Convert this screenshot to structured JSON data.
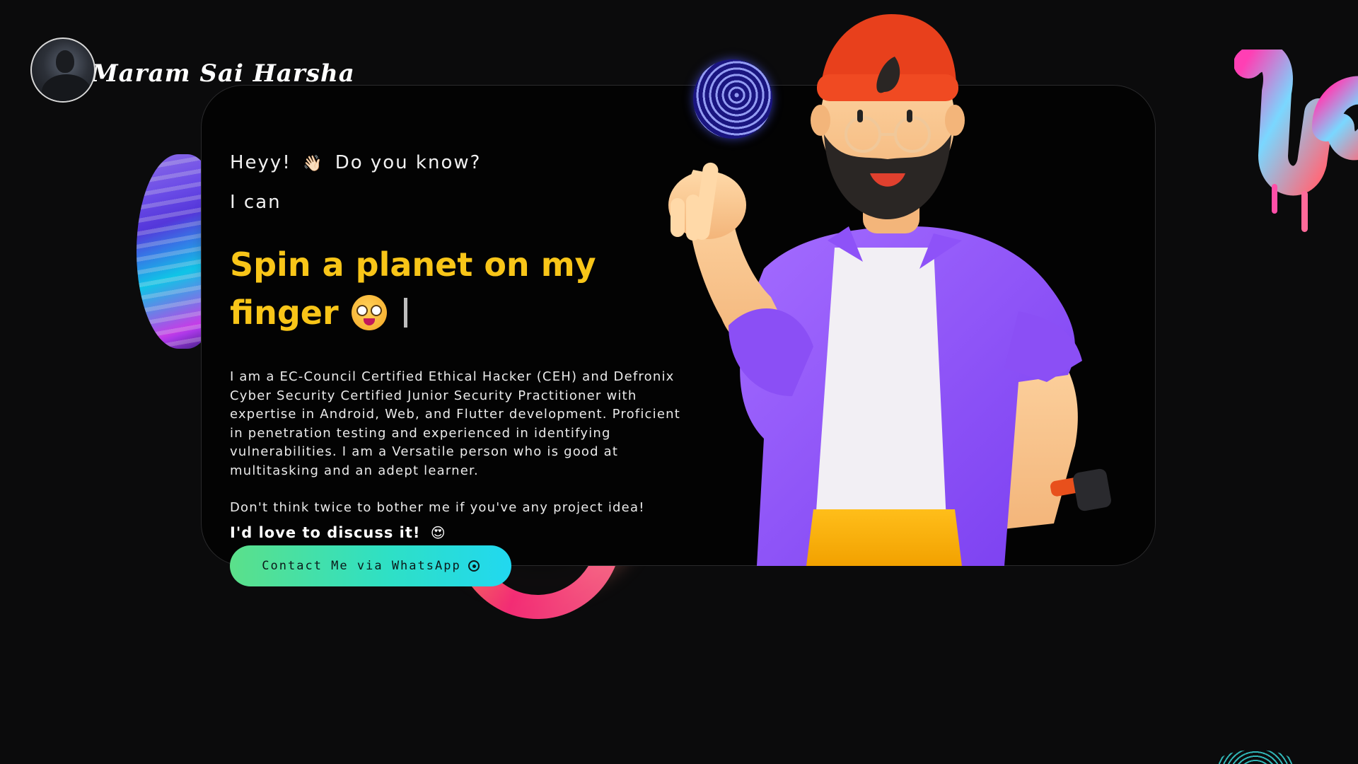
{
  "brand": {
    "name": "Maram Sai Harsha"
  },
  "hero": {
    "greeting": "Heyy!",
    "greeting_wave": "👋🏻",
    "greeting_tail": "Do you know?",
    "ican": "I can",
    "headline": "Spin a planet on my finger",
    "bio": "I am a EC-Council Certified Ethical Hacker (CEH) and Defronix Cyber Security Certified Junior Security Practitioner with expertise in Android, Web, and Flutter development. Proficient in penetration testing and experienced in identifying vulnerabilities. I am a Versatile person who is good at multitasking and an adept learner.",
    "invite": "Don't think twice to bother me if you've any project idea!",
    "discuss": "I'd love to discuss it!",
    "discuss_emoji": "😍"
  },
  "cta": {
    "label": "Contact Me via WhatsApp",
    "icon": "whatsapp-icon"
  },
  "colors": {
    "background": "#0b0b0c",
    "headline": "#f8c518",
    "cta_start": "#5be08a",
    "cta_end": "#21d8f0"
  }
}
